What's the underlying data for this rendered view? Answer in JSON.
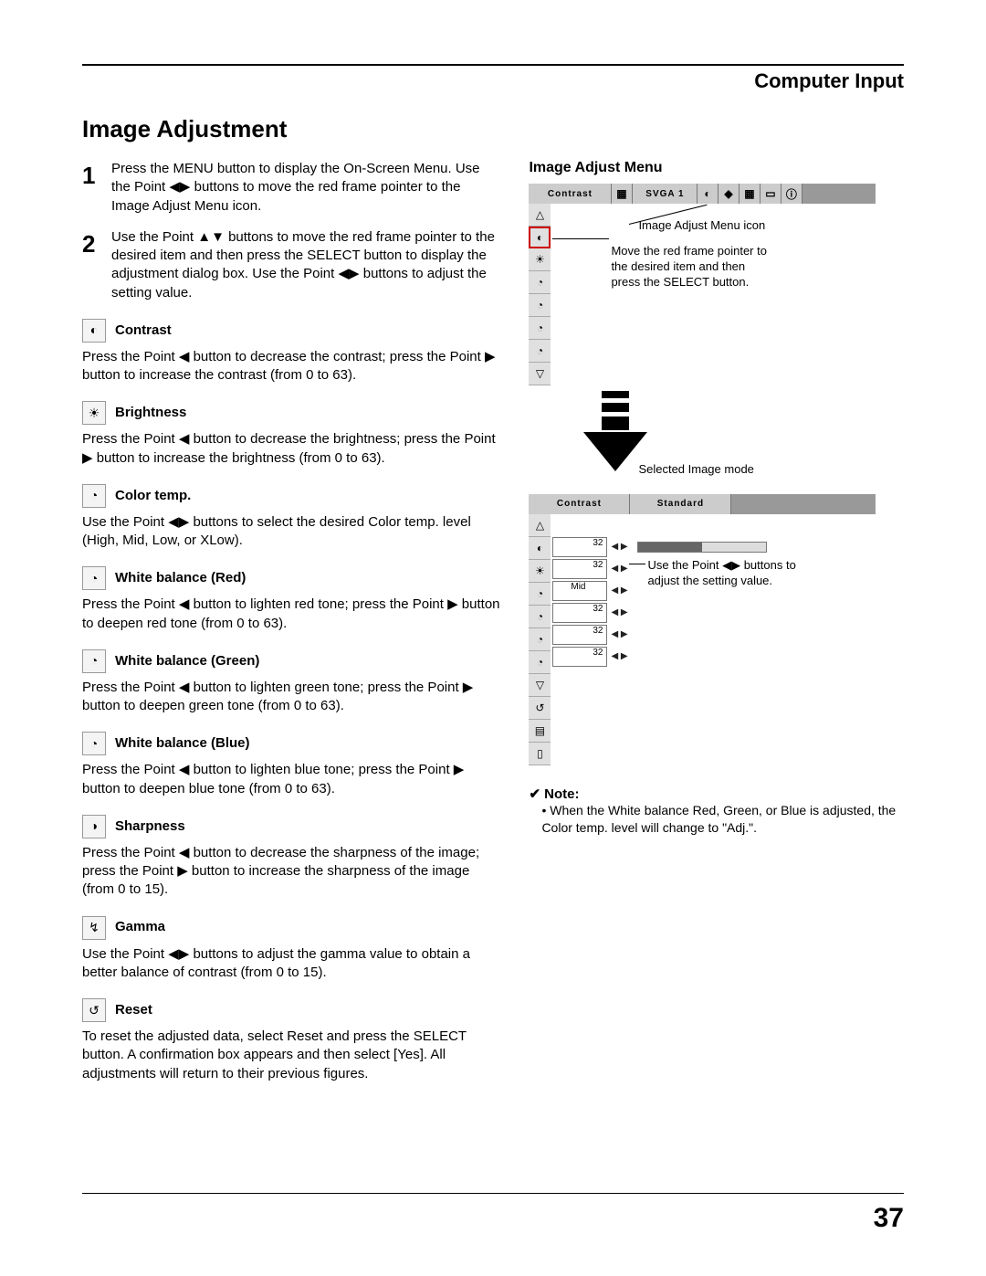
{
  "header": {
    "section": "Computer Input"
  },
  "title": "Image Adjustment",
  "steps": [
    {
      "num": "1",
      "text": "Press the MENU button to display the On-Screen Menu. Use the Point ◀▶ buttons to move the red frame pointer to the Image Adjust Menu icon."
    },
    {
      "num": "2",
      "text": "Use the Point ▲▼ buttons to move the red frame pointer to the desired item and then press the SELECT button to display the adjustment dialog box. Use the Point ◀▶ buttons to adjust the setting value."
    }
  ],
  "params": [
    {
      "icon": "◐",
      "name": "Contrast",
      "desc": "Press the Point ◀ button to decrease the contrast; press the Point ▶ button to increase the contrast (from 0 to 63)."
    },
    {
      "icon": "☀",
      "name": "Brightness",
      "desc": "Press the Point ◀ button to decrease the brightness; press the Point ▶ button to increase the brightness (from 0 to 63)."
    },
    {
      "icon": "◔",
      "name": "Color temp.",
      "desc": "Use the Point ◀▶ buttons to select the desired Color temp. level (High, Mid, Low, or XLow)."
    },
    {
      "icon": "◔",
      "name": "White balance (Red)",
      "desc": "Press the Point ◀ button to lighten red tone; press the Point ▶ button to deepen red tone (from 0 to 63)."
    },
    {
      "icon": "◔",
      "name": "White balance (Green)",
      "desc": "Press the Point ◀ button to lighten green tone; press the Point ▶ button to deepen green tone (from 0 to 63)."
    },
    {
      "icon": "◔",
      "name": "White balance (Blue)",
      "desc": "Press the Point ◀ button to lighten blue tone; press the Point ▶ button to deepen blue tone (from 0 to 63)."
    },
    {
      "icon": "◑",
      "name": "Sharpness",
      "desc": "Press the Point ◀ button to decrease the sharpness of the image; press the Point ▶ button to increase the sharpness of the image (from 0 to 15)."
    },
    {
      "icon": "↯",
      "name": "Gamma",
      "desc": "Use the Point ◀▶ buttons to adjust the gamma value to obtain a better balance of contrast (from 0 to 15)."
    },
    {
      "icon": "↺",
      "name": "Reset",
      "desc": "To reset the adjusted data, select Reset and press the SELECT button. A confirmation box appears and then select [Yes]. All adjustments will return to their previous figures."
    }
  ],
  "right": {
    "heading": "Image Adjust Menu",
    "topbar_label": "Contrast",
    "topbar_mode": "SVGA 1",
    "callout_icon": "Image Adjust Menu icon",
    "callout_pointer": "Move the red frame pointer to the desired item and then press the SELECT button.",
    "callout_mode": "Selected Image mode",
    "dialog_label": "Contrast",
    "dialog_mode": "Standard",
    "values": [
      "32",
      "32",
      "Mid",
      "32",
      "32",
      "32"
    ],
    "callout_adjust": "Use the Point ◀▶ buttons to adjust the setting value."
  },
  "note": {
    "head": "✔ Note:",
    "body": "• When the White balance Red, Green, or Blue is adjusted, the Color temp. level will change to \"Adj.\"."
  },
  "page_number": "37"
}
